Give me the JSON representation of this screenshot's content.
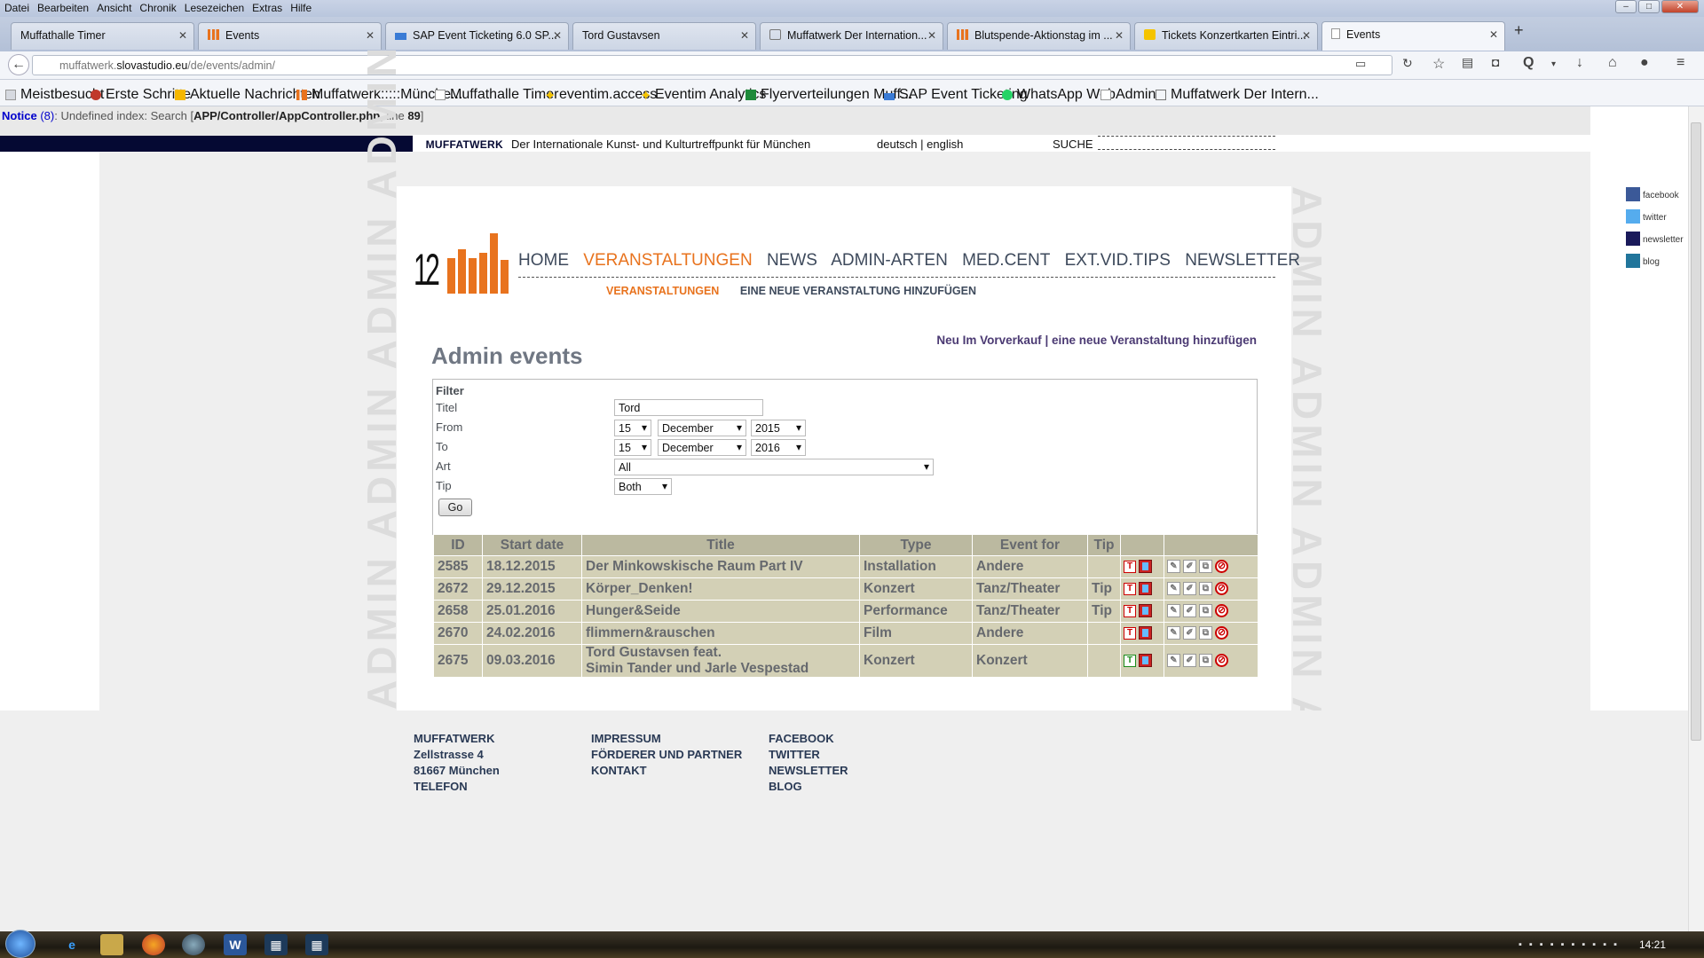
{
  "browser": {
    "menu": [
      "Datei",
      "Bearbeiten",
      "Ansicht",
      "Chronik",
      "Lesezeichen",
      "Extras",
      "Hilfe"
    ],
    "tabs": [
      {
        "label": "Muffathalle Timer"
      },
      {
        "label": "Events"
      },
      {
        "label": "SAP Event Ticketing 6.0 SP..."
      },
      {
        "label": "Tord Gustavsen"
      },
      {
        "label": "Muffatwerk Der Internation..."
      },
      {
        "label": "Blutspende-Aktionstag im ..."
      },
      {
        "label": "Tickets Konzertkarten Eintri..."
      },
      {
        "label": "Events"
      }
    ],
    "url_prefix": "muffatwerk.",
    "url_host": "slovastudio.eu",
    "url_path": "/de/events/admin/",
    "bookmarks": [
      "Meistbesucht",
      "Erste Schritte",
      "Aktuelle Nachrichten",
      "Muffatwerk:::::Münche...",
      "Muffathalle Timer",
      "eventim.access",
      "Eventim Analytics",
      "Flyerverteilungen Muff...",
      "SAP Event Ticketing",
      "WhatsApp Web",
      "Admin",
      "Muffatwerk Der Intern..."
    ]
  },
  "notice": {
    "label": "Notice",
    "code": " (8)",
    "message": ": Undefined index: Search [",
    "file": "APP/Controller/AppController.php",
    "line_text": ", line ",
    "line": "89",
    "end": "]"
  },
  "site": {
    "brand": "MUFFATWERK",
    "tagline": "Der Internationale Kunst- und Kulturtreffpunkt für München",
    "lang": "deutsch | english",
    "search_label": "SUCHE",
    "watermark": "ADMIN ADMIN ADMIN ADMIN",
    "logo_text": "12",
    "nav": [
      "HOME",
      "VERANSTALTUNGEN",
      "NEWS",
      "ADMIN-ARTEN",
      "MED.CENT",
      "EXT.VID.TIPS",
      "NEWSLETTER"
    ],
    "subnav": [
      "VERANSTALTUNGEN",
      "EINE NEUE VERANSTALTUNG HINZUFÜGEN"
    ]
  },
  "page": {
    "title": "Admin events",
    "link_presale": "Neu Im Vorverkauf",
    "link_sep": " | ",
    "link_add": "eine neue Veranstaltung hinzufügen"
  },
  "filter": {
    "heading": "Filter",
    "titel_label": "Titel",
    "titel_value": "Tord",
    "from_label": "From",
    "from_day": "15",
    "from_month": "December",
    "from_year": "2015",
    "to_label": "To",
    "to_day": "15",
    "to_month": "December",
    "to_year": "2016",
    "art_label": "Art",
    "art_value": "All",
    "tip_label": "Tip",
    "tip_value": "Both",
    "go": "Go"
  },
  "table": {
    "headers": [
      "ID",
      "Start date",
      "Title",
      "Type",
      "Event for",
      "Tip"
    ],
    "rows": [
      {
        "id": "2585",
        "date": "18.12.2015",
        "title1": "Der Minkowskische Raum Part IV",
        "title2": "",
        "type": "Installation",
        "for": "Andere",
        "tip": "",
        "t_color": "red"
      },
      {
        "id": "2672",
        "date": "29.12.2015",
        "title1": "Körper_Denken!",
        "title2": "",
        "type": "Konzert",
        "for": "Tanz/Theater",
        "tip": "Tip",
        "t_color": "red"
      },
      {
        "id": "2658",
        "date": "25.01.2016",
        "title1": "Hunger&Seide",
        "title2": "",
        "type": "Performance",
        "for": "Tanz/Theater",
        "tip": "Tip",
        "t_color": "red"
      },
      {
        "id": "2670",
        "date": "24.02.2016",
        "title1": "flimmern&rauschen",
        "title2": "",
        "type": "Film",
        "for": "Andere",
        "tip": "",
        "t_color": "red"
      },
      {
        "id": "2675",
        "date": "09.03.2016",
        "title1": "Tord Gustavsen feat.",
        "title2": "Simin Tander und Jarle Vespestad",
        "type": "Konzert",
        "for": "Konzert",
        "tip": "",
        "t_color": "green"
      }
    ]
  },
  "footer": {
    "col1": [
      "MUFFATWERK",
      "Zellstrasse 4",
      "81667 München",
      "TELEFON"
    ],
    "col2": [
      "IMPRESSUM",
      "FÖRDERER UND PARTNER",
      "KONTAKT"
    ],
    "col3": [
      "FACEBOOK",
      "TWITTER",
      "NEWSLETTER",
      "BLOG"
    ]
  },
  "social": [
    "facebook",
    "twitter",
    "newsletter",
    "blog"
  ],
  "taskbar": {
    "clock": "14:21"
  },
  "colors": {
    "accent": "#e8731e",
    "nav": "#3e4a5c",
    "header_bar": "#050933",
    "table_row": "#d3d0b6",
    "table_head": "#bbb9a0"
  }
}
